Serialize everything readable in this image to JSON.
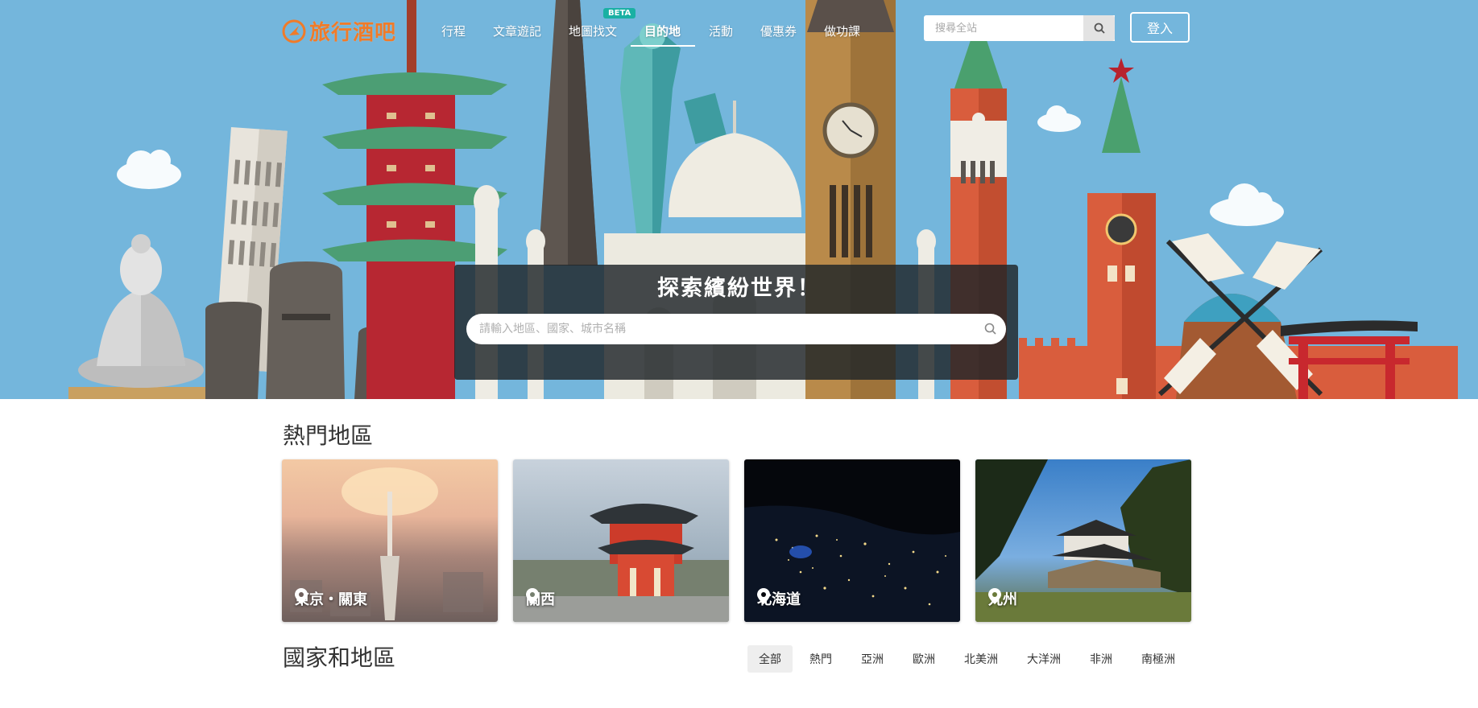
{
  "brand": {
    "logo_text": "旅行酒吧",
    "logo_icon": "travel-logo-icon",
    "color": "#f07b29"
  },
  "nav": {
    "items": [
      {
        "label": "行程"
      },
      {
        "label": "文章遊記"
      },
      {
        "label": "地圖找文"
      },
      {
        "label": "目的地"
      },
      {
        "label": "活動"
      },
      {
        "label": "優惠券"
      },
      {
        "label": "做功課"
      }
    ],
    "active": "目的地",
    "beta_badge": "BETA",
    "search_placeholder": "搜尋全站",
    "search_icon": "search-icon",
    "login_label": "登入"
  },
  "hero": {
    "title": "探索繽紛世界！",
    "search_placeholder": "請輸入地區、國家、城市名稱",
    "search_icon": "search-icon"
  },
  "popular": {
    "title": "熱門地區",
    "cards": [
      {
        "label": "東京・關東",
        "icon": "map-pin-icon"
      },
      {
        "label": "關西",
        "icon": "map-pin-icon"
      },
      {
        "label": "北海道",
        "icon": "map-pin-icon"
      },
      {
        "label": "九州",
        "icon": "map-pin-icon"
      }
    ]
  },
  "countries": {
    "title": "國家和地區",
    "filters": [
      {
        "label": "全部"
      },
      {
        "label": "熱門"
      },
      {
        "label": "亞洲"
      },
      {
        "label": "歐洲"
      },
      {
        "label": "北美洲"
      },
      {
        "label": "大洋洲"
      },
      {
        "label": "非洲"
      },
      {
        "label": "南極洲"
      }
    ],
    "active_filter": "全部"
  },
  "colors": {
    "sky": "#74b6dc",
    "beta": "#1ab0a3",
    "panel": "#1e2428"
  }
}
